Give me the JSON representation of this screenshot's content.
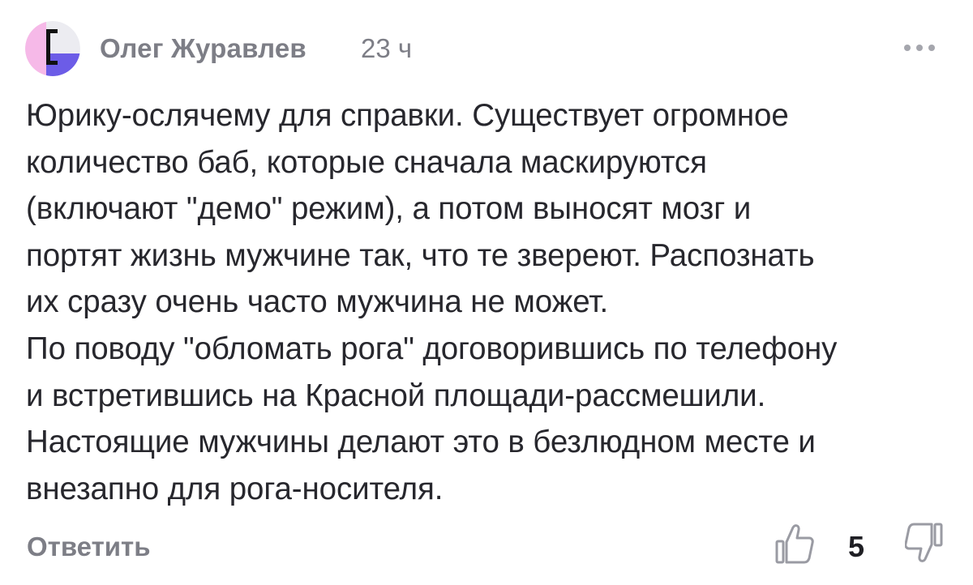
{
  "comment": {
    "author": "Олег Журавлев",
    "time": "23 ч",
    "text_lines": [
      "Юрику-ослячему для справки. Существует огромное",
      "количество баб, которые сначала маскируются",
      "(включают \"демо\" режим), а потом выносят мозг и",
      "портят жизнь мужчине так, что те зверeют. Распознать",
      "их сразу очень часто мужчина не может.",
      "По поводу \"обломать рога\" договорившись по телефону",
      "и встретившись на Красной площади-рассмешили.",
      "Настоящие мужчины делают это в безлюдном месте и",
      "внезапно для рога-носителя."
    ],
    "reply_label": "Ответить",
    "score": "5"
  },
  "icons": {
    "avatar": "avatar-logo",
    "more": "more-dots-icon",
    "like": "thumbs-up-icon",
    "dislike": "thumbs-down-icon"
  },
  "colors": {
    "meta_text": "#7d7e86",
    "body_text": "#27272d",
    "avatar_pink": "#f5b8e6",
    "avatar_purple": "#6c5ce7"
  }
}
